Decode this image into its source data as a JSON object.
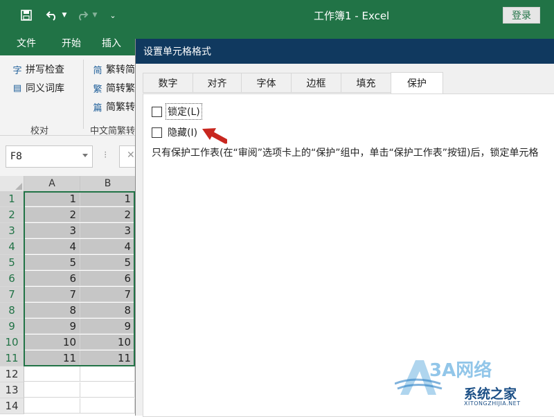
{
  "title_bar": {
    "title": "工作簿1  -  Excel",
    "login_label": "登录"
  },
  "ribbon_tabs": [
    "文件",
    "开始",
    "插入"
  ],
  "ribbon": {
    "proofing": {
      "items": [
        "拼写检查",
        "同义词库"
      ],
      "group_label": "校对"
    },
    "chinese_conversion": {
      "items": [
        "繁转简",
        "简转繁",
        "简繁转换"
      ],
      "group_label": "中文简繁转换"
    }
  },
  "name_box": {
    "value": "F8"
  },
  "sheet": {
    "columns": [
      "A",
      "B"
    ],
    "rows": [
      {
        "num": "1",
        "a": "1",
        "b": "1",
        "selected": true
      },
      {
        "num": "2",
        "a": "2",
        "b": "2",
        "selected": true
      },
      {
        "num": "3",
        "a": "3",
        "b": "3",
        "selected": true
      },
      {
        "num": "4",
        "a": "4",
        "b": "4",
        "selected": true
      },
      {
        "num": "5",
        "a": "5",
        "b": "5",
        "selected": true
      },
      {
        "num": "6",
        "a": "6",
        "b": "6",
        "selected": true
      },
      {
        "num": "7",
        "a": "7",
        "b": "7",
        "selected": true
      },
      {
        "num": "8",
        "a": "8",
        "b": "8",
        "selected": true
      },
      {
        "num": "9",
        "a": "9",
        "b": "9",
        "selected": true
      },
      {
        "num": "10",
        "a": "10",
        "b": "10",
        "selected": true
      },
      {
        "num": "11",
        "a": "11",
        "b": "11",
        "selected": true
      },
      {
        "num": "12",
        "a": "",
        "b": "",
        "selected": false
      },
      {
        "num": "13",
        "a": "",
        "b": "",
        "selected": false
      },
      {
        "num": "14",
        "a": "",
        "b": "",
        "selected": false
      }
    ]
  },
  "dialog": {
    "title": "设置单元格格式",
    "tabs": [
      "数字",
      "对齐",
      "字体",
      "边框",
      "填充",
      "保护"
    ],
    "active_tab": "保护",
    "protection": {
      "locked": {
        "label": "锁定(L)",
        "checked": false
      },
      "hidden": {
        "label": "隐藏(I)",
        "checked": false
      },
      "note": "只有保护工作表(在“审阅”选项卡上的“保护”组中，单击“保护工作表”按钮)后，锁定单元格"
    }
  },
  "watermark": {
    "logo": "3A网络",
    "brand": "系统之家",
    "url": "XITONGZHIJIA.NET"
  },
  "colors": {
    "excel_green": "#217346",
    "dialog_title": "#10395f",
    "selection_fill": "#c6c6c6",
    "arrow": "#c8271f"
  }
}
